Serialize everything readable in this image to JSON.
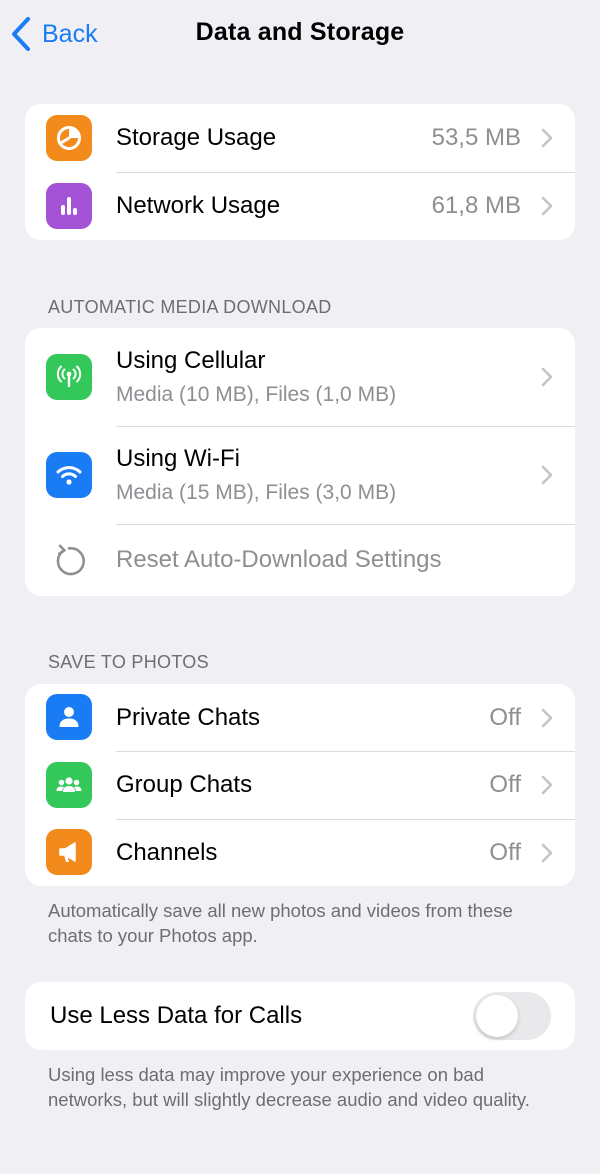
{
  "nav": {
    "back_label": "Back",
    "title": "Data and Storage"
  },
  "usage": [
    {
      "label": "Storage Usage",
      "value": "53,5 MB",
      "icon": "pie-chart-icon",
      "color": "#f38b1c"
    },
    {
      "label": "Network Usage",
      "value": "61,8 MB",
      "icon": "bar-chart-icon",
      "color": "#a553d6"
    }
  ],
  "auto_download": {
    "header": "AUTOMATIC MEDIA DOWNLOAD",
    "cellular": {
      "label": "Using Cellular",
      "sub": "Media (10 MB), Files (1,0 MB)",
      "icon": "antenna-icon",
      "color": "#34c759"
    },
    "wifi": {
      "label": "Using Wi-Fi",
      "sub": "Media (15 MB), Files (3,0 MB)",
      "icon": "wifi-icon",
      "color": "#1a7cf5"
    },
    "reset_label": "Reset Auto-Download Settings"
  },
  "save_photos": {
    "header": "SAVE TO PHOTOS",
    "items": [
      {
        "label": "Private Chats",
        "value": "Off",
        "icon": "person-icon",
        "color": "#1a7cf5"
      },
      {
        "label": "Group Chats",
        "value": "Off",
        "icon": "group-icon",
        "color": "#34c759"
      },
      {
        "label": "Channels",
        "value": "Off",
        "icon": "megaphone-icon",
        "color": "#f38b1c"
      }
    ],
    "footer": "Automatically save all new photos and videos from these chats to your Photos app."
  },
  "calls": {
    "label": "Use Less Data for Calls",
    "enabled": false,
    "footer": "Using less data may improve your experience on bad networks, but will slightly decrease audio and video quality."
  }
}
